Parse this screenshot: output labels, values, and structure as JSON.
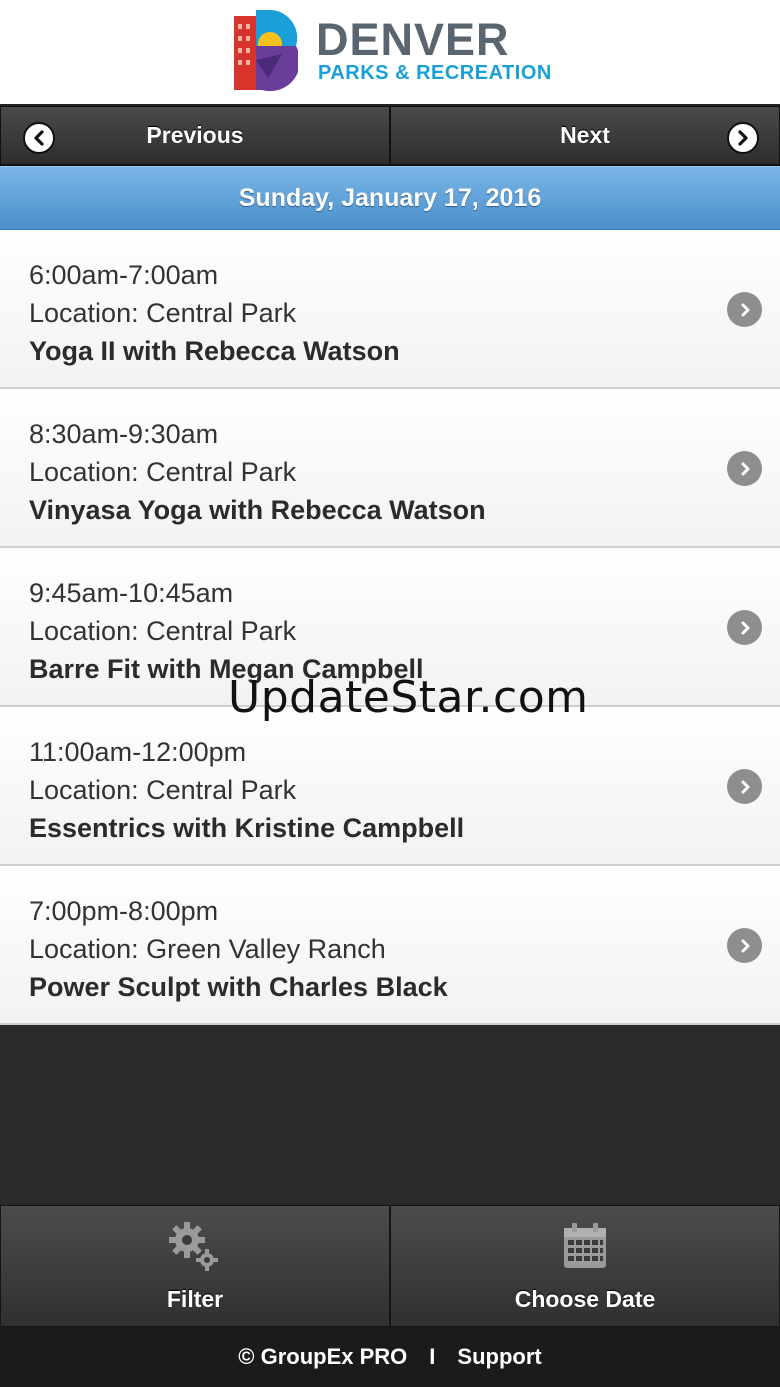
{
  "header": {
    "logo_title": "DENVER",
    "logo_subtitle": "PARKS & RECREATION"
  },
  "nav": {
    "previous_label": "Previous",
    "next_label": "Next"
  },
  "date": "Sunday, January 17, 2016",
  "classes": [
    {
      "time": "6:00am-7:00am",
      "location": "Location: Central Park",
      "title": "Yoga II with Rebecca Watson"
    },
    {
      "time": "8:30am-9:30am",
      "location": "Location: Central Park",
      "title": "Vinyasa Yoga with Rebecca Watson"
    },
    {
      "time": "9:45am-10:45am",
      "location": "Location: Central Park",
      "title": "Barre Fit with Megan Campbell"
    },
    {
      "time": "11:00am-12:00pm",
      "location": "Location: Central Park",
      "title": "Essentrics with Kristine Campbell"
    },
    {
      "time": "7:00pm-8:00pm",
      "location": "Location: Green Valley Ranch",
      "title": "Power Sculpt with Charles Black"
    }
  ],
  "watermark": "UpdateStar.com",
  "toolbar": {
    "filter_label": "Filter",
    "choose_date_label": "Choose Date"
  },
  "footer": {
    "brand": "© GroupEx PRO",
    "separator": "I",
    "support": "Support"
  },
  "colors": {
    "date_bar": "#4a8fcc",
    "logo_blue": "#1a9fd9",
    "logo_grey": "#5b6570",
    "dark_bg": "#2a2a2a"
  }
}
